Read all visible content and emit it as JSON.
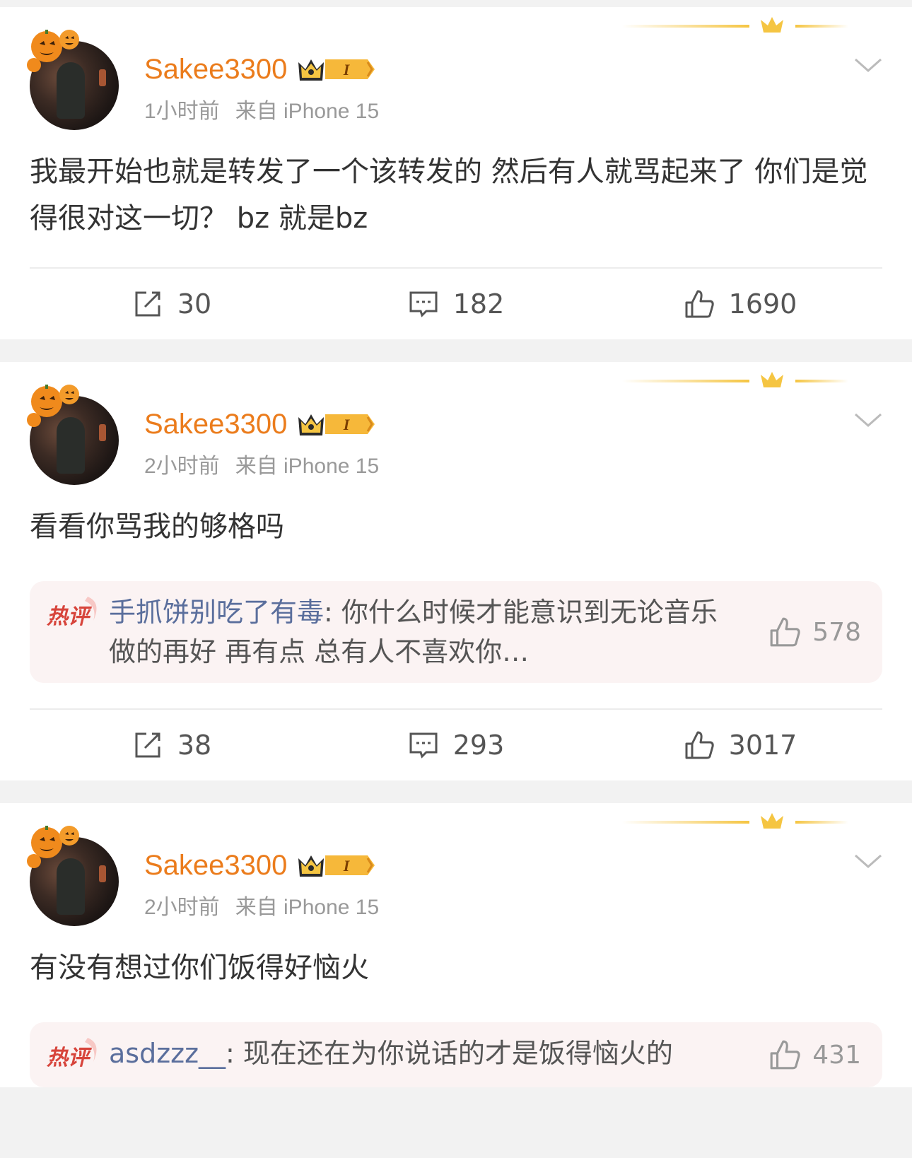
{
  "colors": {
    "username": "#eb7c1c",
    "hot_user": "#5a6e9c",
    "hot_badge": "#d7443b"
  },
  "posts": [
    {
      "username": "Sakee3300",
      "vip_level": "I",
      "time": "1小时前",
      "source": "来自 iPhone 15",
      "content": "我最开始也就是转发了一个该转发的 然后有人就骂起来了 你们是觉得很对这一切？ bz 就是bz",
      "reposts": "30",
      "comments": "182",
      "likes": "1690"
    },
    {
      "username": "Sakee3300",
      "vip_level": "I",
      "time": "2小时前",
      "source": "来自 iPhone 15",
      "content": "看看你骂我的够格吗",
      "hot_comment": {
        "badge": "热评",
        "user": "手抓饼别吃了有毒",
        "text": ": 你什么时候才能意识到无论音乐做的再好 再有点 总有人不喜欢你…",
        "likes": "578"
      },
      "reposts": "38",
      "comments": "293",
      "likes": "3017"
    },
    {
      "username": "Sakee3300",
      "vip_level": "I",
      "time": "2小时前",
      "source": "来自 iPhone 15",
      "content": "有没有想过你们饭得好恼火",
      "hot_comment": {
        "badge": "热评",
        "user": "asdzzz__",
        "text": ": 现在还在为你说话的才是饭得恼火的",
        "likes": "431"
      }
    }
  ]
}
